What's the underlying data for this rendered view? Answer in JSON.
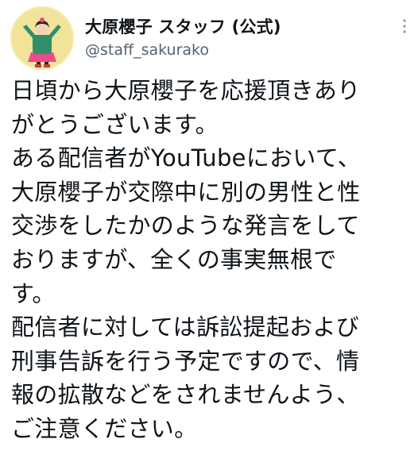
{
  "author": {
    "display_name": "大原櫻子 スタッフ (公式)",
    "handle": "@staff_sakurako"
  },
  "icons": {
    "avatar": "profile-photo",
    "more": "vertical-dots-icon"
  },
  "colors": {
    "text": "#0f1419",
    "handle": "#536471",
    "background": "#ffffff"
  },
  "tweet": {
    "lines": [
      "日頃から大原櫻子を応援頂きあり",
      "がとうございます。",
      "ある配信者がYouTubeにおいて、",
      "大原櫻子が交際中に別の男性と性",
      "交渉をしたかのような発言をして",
      "おりますが、全くの事実無根で",
      "す。",
      "配信者に対しては訴訟提起および",
      "刑事告訴を行う予定ですので、情",
      "報の拡散などをされませんよう、",
      "ご注意ください。"
    ]
  }
}
